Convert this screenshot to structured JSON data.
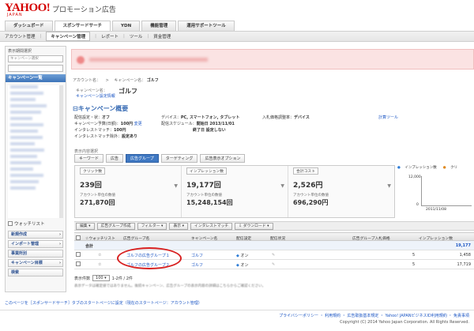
{
  "brand": {
    "logo": "YAHOO!",
    "logo_sub": "JAPAN",
    "app_title": "プロモーション広告"
  },
  "main_tabs": [
    {
      "label": "ダッシュボード"
    },
    {
      "label": "スポンサードサーチ"
    },
    {
      "label": "YDN"
    },
    {
      "label": "機能管理"
    },
    {
      "label": "運用サポートツール"
    }
  ],
  "subnav": [
    {
      "label": "アカウント管理"
    },
    {
      "label": "キャンペーン管理"
    },
    {
      "label": "レポート"
    },
    {
      "label": "ツール"
    },
    {
      "label": "資金管理"
    }
  ],
  "sidebar": {
    "head": "表示期間選択",
    "select_value": "キャンペーン選択",
    "list_title": "キャンペーン一覧",
    "checklist": "ウォッチリスト",
    "buttons": [
      {
        "label": "新規作成"
      },
      {
        "label": "インポート管理"
      },
      {
        "label": "事業所別"
      },
      {
        "label": "キャンペーン目標"
      },
      {
        "label": "検索"
      }
    ]
  },
  "breadcrumb": {
    "account": "アカウント名：",
    "campaign": "キャンペーン名：",
    "current": "ゴルフ"
  },
  "campaign": {
    "name_label": "キャンペーン名：",
    "name": "ゴルフ",
    "settings_link": "キャンペーン設定情報"
  },
  "section_title": "キャンペーン概要",
  "summary": {
    "col1": [
      {
        "k": "配信設定・状：",
        "v": "オフ"
      },
      {
        "k": "キャンペーン予算(日額)：",
        "v": "100円",
        "link": "変更"
      },
      {
        "k": "インタレストマッチ：",
        "v": "100円"
      },
      {
        "k": "インタレストマッチ除外：",
        "v": "設定あり"
      }
    ],
    "col2": [
      {
        "k": "デバイス：",
        "v": "PC, スマートフォン, タブレット"
      },
      {
        "k": "配信スケジュール：",
        "v": "開始日 2013/11/01"
      },
      {
        "k": "",
        "v": "終了日 設定しない"
      }
    ],
    "col3": [
      {
        "k": "入札価格調整率：",
        "v": "デバイス"
      }
    ],
    "col4": [
      {
        "link": "計算ツール"
      }
    ]
  },
  "content_tabs_label": "表示内容選択",
  "content_tabs": [
    {
      "label": "キーワード"
    },
    {
      "label": "広告"
    },
    {
      "label": "広告グループ",
      "active": true
    },
    {
      "label": "ターゲティング"
    },
    {
      "label": "広告表示オプション"
    }
  ],
  "stats": [
    {
      "label": "クリック数",
      "value": "239回",
      "sub_label": "アカウント単位の数値",
      "sub_value": "271,870回"
    },
    {
      "label": "インプレッション数",
      "value": "19,177回",
      "sub_label": "アカウント単位の数値",
      "sub_value": "15,248,154回"
    },
    {
      "label": "合計コスト",
      "value": "2,526円",
      "sub_label": "アカウント単位の数値",
      "sub_value": "696,290円"
    }
  ],
  "mini_chart": {
    "legend": [
      "インプレッション数",
      "クリ"
    ],
    "y_top": "12,000",
    "y_bottom": "0",
    "x_label": "2011/11/08"
  },
  "toolbar": [
    {
      "label": "編集"
    },
    {
      "label": "広告グループ作成"
    },
    {
      "label": "フィルター"
    },
    {
      "label": "表示"
    },
    {
      "label": "インタレストマッチ"
    },
    {
      "label": "ダウンロード"
    }
  ],
  "table": {
    "headers": {
      "watch": "ウォッチリスト",
      "adgroup": "広告グループ名",
      "campaign": "キャンペーン名",
      "status": "配信設定",
      "state": "配信状況",
      "bid": "広告グループ入札価格",
      "impressions": "インプレッション数"
    },
    "total": {
      "label": "合計",
      "impressions": "19,177"
    },
    "rows": [
      {
        "adgroup": "ゴルフの広告グループ１",
        "campaign": "ゴルフ",
        "status": "オン",
        "bid": "5",
        "impressions": "1,458"
      },
      {
        "adgroup": "ゴルフの広告グループ２",
        "campaign": "ゴルフ",
        "status": "オン",
        "bid": "5",
        "impressions": "17,719"
      }
    ]
  },
  "pager": {
    "prefix": "表示件数",
    "per_page": "100",
    "range": "1-2件 / 2件"
  },
  "note": "表示データは確定値ではありません。後続キャンペーン、広告グループの表示内容の詳細はこちらからご確認ください。",
  "bottom_link": "このページを［スポンサードサーチ］タブのスタートページに設定（現在のスタートページ：アカウント管理）",
  "footer_links": "プライバシーポリシー ・ 利用規約 ・ 広告取扱基本規定 ・ Yahoo! JAPANビジネスID利用規約 ・ 免責事項",
  "copyright": "Copyright (C) 2014 Yahoo Japan Corporation. All Rights Reserved."
}
